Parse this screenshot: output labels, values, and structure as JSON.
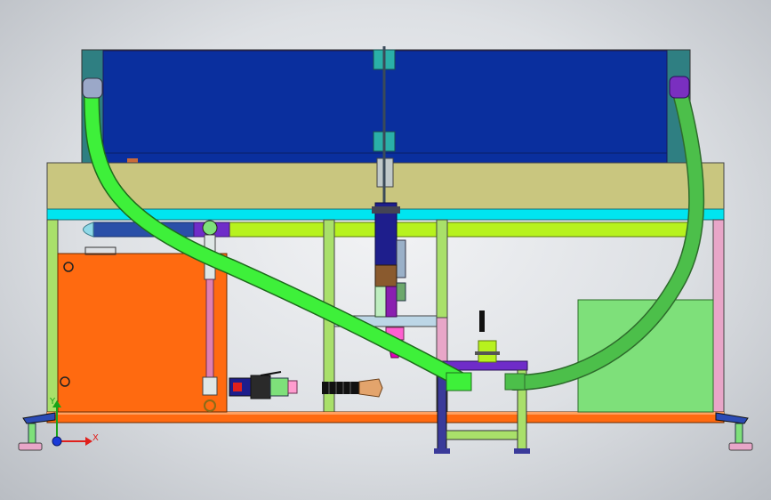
{
  "triad": {
    "x_label": "X",
    "y_label": "Y"
  },
  "colors": {
    "background": "#dde0e4",
    "tank": "#0a2f9e",
    "frame_top": "#c9c67f",
    "rail": "#00e5f0",
    "pipe": "#b7f21e",
    "hose": "#3ef03a",
    "hose_dark": "#4cbf4a",
    "orange_box": "#ff6a10",
    "base_plate": "#ff6a10",
    "green_panel": "#7ee07a",
    "violet": "#6f2cc9",
    "cylinder": "#1e1e8c",
    "axis_x": "#e0201c",
    "axis_y": "#18a418"
  }
}
